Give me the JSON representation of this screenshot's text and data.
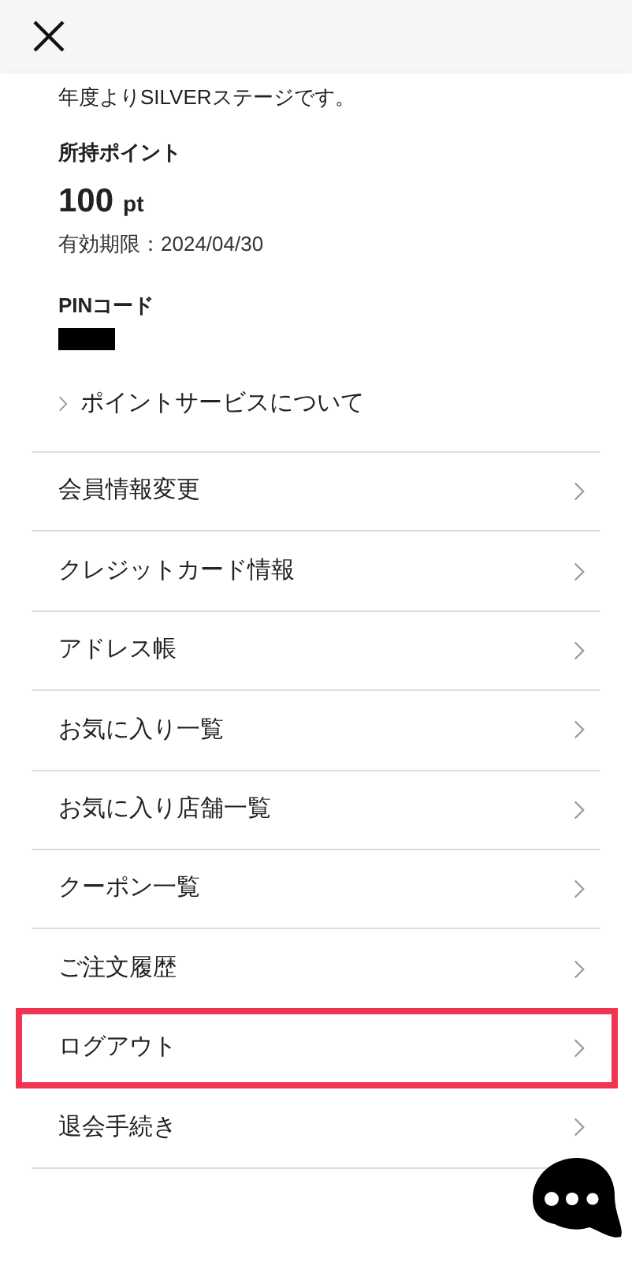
{
  "stage_note": "年度よりSILVERステージです。",
  "points": {
    "label": "所持ポイント",
    "value": "100",
    "unit": "pt",
    "expiry": "有効期限：2024/04/30"
  },
  "pin": {
    "label": "PINコード"
  },
  "point_service_link": "ポイントサービスについて",
  "menu": [
    {
      "label": "会員情報変更",
      "highlighted": false
    },
    {
      "label": "クレジットカード情報",
      "highlighted": false
    },
    {
      "label": "アドレス帳",
      "highlighted": false
    },
    {
      "label": "お気に入り一覧",
      "highlighted": false
    },
    {
      "label": "お気に入り店舗一覧",
      "highlighted": false
    },
    {
      "label": "クーポン一覧",
      "highlighted": false
    },
    {
      "label": "ご注文履歴",
      "highlighted": false
    },
    {
      "label": "ログアウト",
      "highlighted": true
    },
    {
      "label": "退会手続き",
      "highlighted": false
    }
  ]
}
